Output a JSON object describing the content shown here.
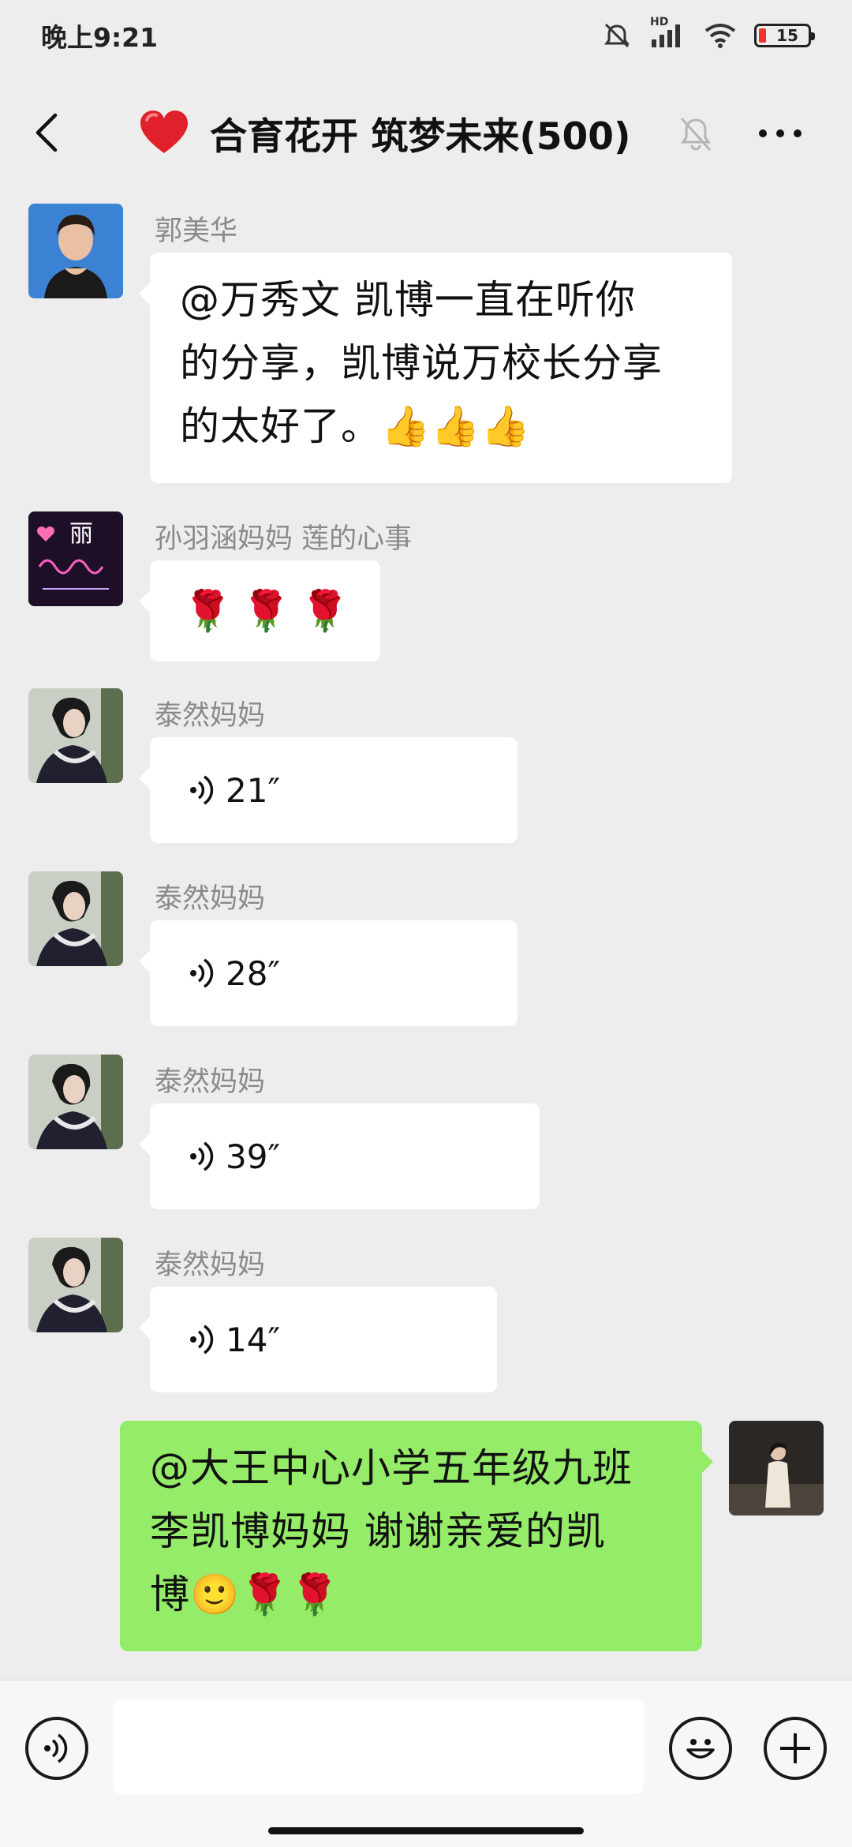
{
  "status_bar": {
    "time": "晚上9:21",
    "battery_level": "15",
    "network_label": "HD"
  },
  "header": {
    "title": "合育花开 筑梦未来(500)",
    "title_icon": "red-heart-icon",
    "muted": true
  },
  "messages": [
    {
      "sender": "郭美华",
      "type": "text",
      "lines": [
        "@万秀文  凯博一直在听你",
        "的分享，凯博说万校长分享",
        "的太好了。"
      ],
      "emoji": [
        "👍",
        "👍",
        "👍"
      ]
    },
    {
      "sender": "孙羽涵妈妈  莲的心事",
      "type": "emoji",
      "emoji": [
        "🌹",
        "🌹",
        "🌹"
      ],
      "avatar_text": "丽"
    },
    {
      "sender": "泰然妈妈",
      "type": "voice",
      "duration": "21″"
    },
    {
      "sender": "泰然妈妈",
      "type": "voice",
      "duration": "28″"
    },
    {
      "sender": "泰然妈妈",
      "type": "voice",
      "duration": "39″"
    },
    {
      "sender": "泰然妈妈",
      "type": "voice",
      "duration": "14″"
    },
    {
      "sender": "me",
      "type": "text",
      "lines": [
        "@大王中心小学五年级九班",
        "李凯博妈妈  谢谢亲爱的凯",
        "博"
      ],
      "emoji": [
        "🙂",
        "🌹",
        "🌹"
      ]
    }
  ],
  "input_bar": {
    "voice_button": "voice-icon",
    "input_placeholder": "",
    "emoji_button": "smiley-icon",
    "plus_button": "plus-icon"
  },
  "colors": {
    "background": "#ededed",
    "bubble_other": "#ffffff",
    "bubble_mine": "#95ec69",
    "sender_name": "#8a8a8a"
  }
}
